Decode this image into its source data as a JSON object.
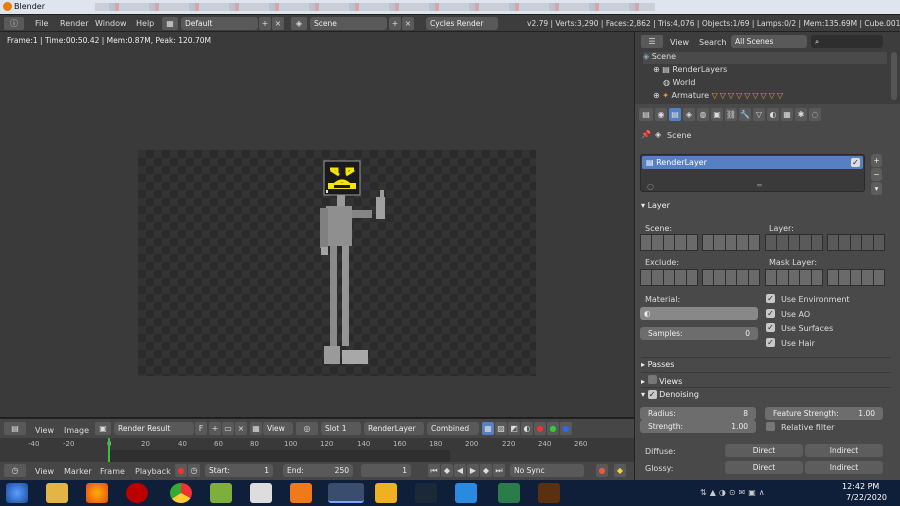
{
  "window": {
    "title": "Blender"
  },
  "infobar": {
    "menu": [
      "File",
      "Render",
      "Window",
      "Help"
    ],
    "layout": "Default",
    "scene": "Scene",
    "engine": "Cycles Render",
    "stats": "v2.79 | Verts:3,290 | Faces:2,862 | Tris:4,076 | Objects:1/69 | Lamps:0/2 | Mem:135.69M | Cube.001"
  },
  "viewport": {
    "info": "Frame:1 | Time:00:50.42 | Mem:0.87M, Peak: 120.70M"
  },
  "image_header": {
    "view": "View",
    "image": "Image",
    "image_name": "Render Result",
    "f_label": "F",
    "view2": "View",
    "slot": "Slot 1",
    "layer": "RenderLayer",
    "pass": "Combined"
  },
  "timeline": {
    "ticks": [
      "-40",
      "-20",
      "0",
      "20",
      "40",
      "60",
      "80",
      "100",
      "120",
      "140",
      "160",
      "180",
      "200",
      "220",
      "240",
      "260"
    ],
    "menu": [
      "View",
      "Marker",
      "Frame",
      "Playback"
    ],
    "start_label": "Start:",
    "start": "1",
    "end_label": "End:",
    "end": "250",
    "current": "1",
    "sync": "No Sync"
  },
  "outliner": {
    "view": "View",
    "search": "Search",
    "filter": "All Scenes",
    "items": [
      {
        "label": "Scene"
      },
      {
        "label": "RenderLayers"
      },
      {
        "label": "World"
      },
      {
        "label": "Armature"
      }
    ]
  },
  "props": {
    "context": "Scene",
    "render_layer": "RenderLayer",
    "layer_panel": {
      "title": "Layer",
      "scene_label": "Scene:",
      "layer_label": "Layer:",
      "exclude_label": "Exclude:",
      "mask_label": "Mask Layer:",
      "material_label": "Material:",
      "checks": [
        "Use Environment",
        "Use AO",
        "Use Surfaces",
        "Use Hair"
      ],
      "samples_label": "Samples:",
      "samples": "0"
    },
    "passes": "Passes",
    "views": "Views",
    "denoising": {
      "title": "Denoising",
      "radius_label": "Radius:",
      "radius": "8",
      "strength_label": "Strength:",
      "strength": "1.00",
      "feature_label": "Feature Strength:",
      "feature": "1.00",
      "relative": "Relative filter"
    },
    "diffuse_label": "Diffuse:",
    "glossy_label": "Glossy:",
    "direct": "Direct",
    "indirect": "Indirect"
  },
  "taskbar": {
    "time": "12:42 PM",
    "date": "7/22/2020"
  },
  "colors": {
    "accent": "#5680c2",
    "header": "#3d3d3d",
    "panel": "#494949"
  }
}
